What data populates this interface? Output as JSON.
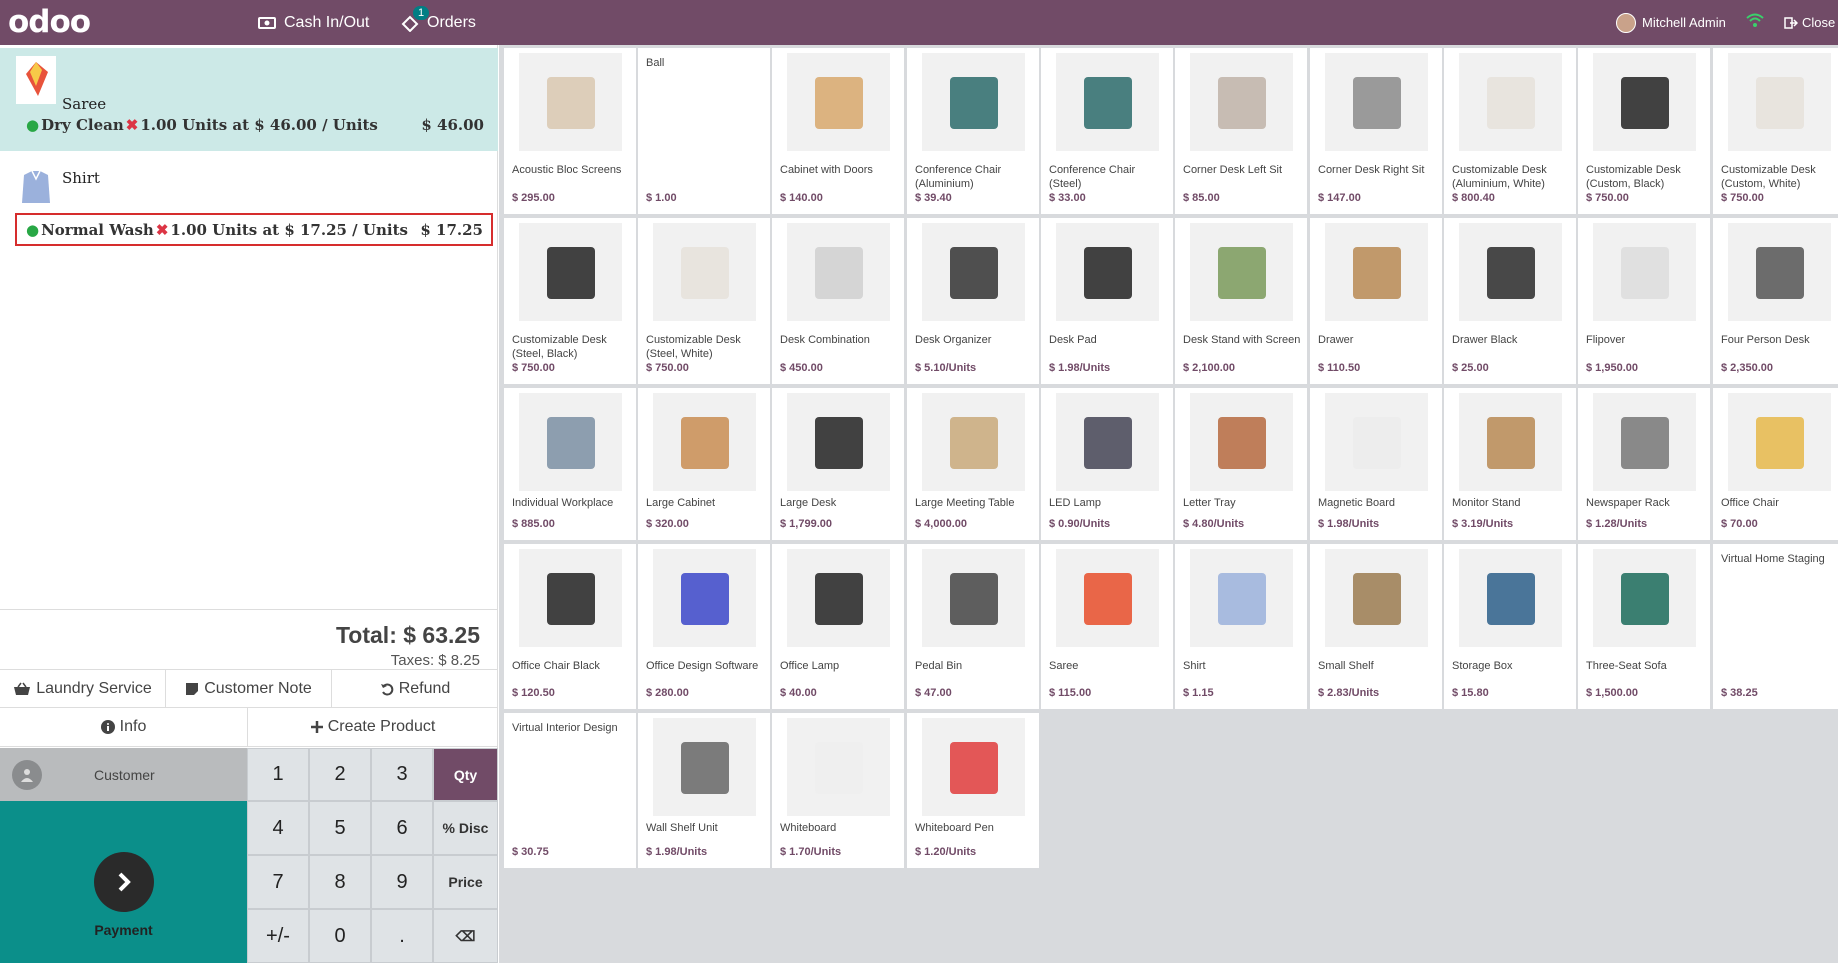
{
  "header": {
    "logo": "odoo",
    "cash_label": "Cash In/Out",
    "orders_label": "Orders",
    "orders_badge": "1",
    "user_name": "Mitchell Admin",
    "close_label": "Close"
  },
  "order": {
    "lines": [
      {
        "product": "Saree",
        "service": "Dry Clean",
        "qty_text": "1.00 Units at $ 46.00 / Units",
        "price": "$ 46.00",
        "selected": true
      },
      {
        "product": "Shirt",
        "service": "Normal Wash",
        "qty_text": "1.00 Units at $ 17.25 / Units",
        "price": "$ 17.25",
        "selected": false
      }
    ],
    "total": "Total: $ 63.25",
    "taxes": "Taxes: $ 8.25"
  },
  "controls": {
    "laundry_service": "Laundry Service",
    "customer_note": "Customer Note",
    "refund": "Refund",
    "info": "Info",
    "create_product": "Create Product",
    "customer": "Customer",
    "payment": "Payment"
  },
  "numpad": {
    "keys": [
      "1",
      "2",
      "3",
      "Qty",
      "4",
      "5",
      "6",
      "% Disc",
      "7",
      "8",
      "9",
      "Price",
      "+/-",
      "0",
      ".",
      "⌫"
    ],
    "active_mode": "Qty"
  },
  "products": [
    {
      "name": "Acoustic Bloc Screens",
      "price": "$ 295.00"
    },
    {
      "name": "Ball",
      "price": "$ 1.00"
    },
    {
      "name": "Cabinet with Doors",
      "price": "$ 140.00"
    },
    {
      "name": "Conference Chair (Aluminium)",
      "price": "$ 39.40"
    },
    {
      "name": "Conference Chair (Steel)",
      "price": "$ 33.00"
    },
    {
      "name": "Corner Desk Left Sit",
      "price": "$ 85.00"
    },
    {
      "name": "Corner Desk Right Sit",
      "price": "$ 147.00"
    },
    {
      "name": "Customizable Desk (Aluminium, White)",
      "price": "$ 800.40"
    },
    {
      "name": "Customizable Desk (Custom, Black)",
      "price": "$ 750.00"
    },
    {
      "name": "Customizable Desk (Custom, White)",
      "price": "$ 750.00"
    },
    {
      "name": "Customizable Desk (Steel, Black)",
      "price": "$ 750.00"
    },
    {
      "name": "Customizable Desk (Steel, White)",
      "price": "$ 750.00"
    },
    {
      "name": "Desk Combination",
      "price": "$ 450.00"
    },
    {
      "name": "Desk Organizer",
      "price": "$ 5.10/Units"
    },
    {
      "name": "Desk Pad",
      "price": "$ 1.98/Units"
    },
    {
      "name": "Desk Stand with Screen",
      "price": "$ 2,100.00"
    },
    {
      "name": "Drawer",
      "price": "$ 110.50"
    },
    {
      "name": "Drawer Black",
      "price": "$ 25.00"
    },
    {
      "name": "Flipover",
      "price": "$ 1,950.00"
    },
    {
      "name": "Four Person Desk",
      "price": "$ 2,350.00"
    },
    {
      "name": "Individual Workplace",
      "price": "$ 885.00"
    },
    {
      "name": "Large Cabinet",
      "price": "$ 320.00"
    },
    {
      "name": "Large Desk",
      "price": "$ 1,799.00"
    },
    {
      "name": "Large Meeting Table",
      "price": "$ 4,000.00"
    },
    {
      "name": "LED Lamp",
      "price": "$ 0.90/Units"
    },
    {
      "name": "Letter Tray",
      "price": "$ 4.80/Units"
    },
    {
      "name": "Magnetic Board",
      "price": "$ 1.98/Units"
    },
    {
      "name": "Monitor Stand",
      "price": "$ 3.19/Units"
    },
    {
      "name": "Newspaper Rack",
      "price": "$ 1.28/Units"
    },
    {
      "name": "Office Chair",
      "price": "$ 70.00"
    },
    {
      "name": "Office Chair Black",
      "price": "$ 120.50"
    },
    {
      "name": "Office Design Software",
      "price": "$ 280.00"
    },
    {
      "name": "Office Lamp",
      "price": "$ 40.00"
    },
    {
      "name": "Pedal Bin",
      "price": "$ 47.00"
    },
    {
      "name": "Saree",
      "price": "$ 115.00"
    },
    {
      "name": "Shirt",
      "price": "$ 1.15"
    },
    {
      "name": "Small Shelf",
      "price": "$ 2.83/Units"
    },
    {
      "name": "Storage Box",
      "price": "$ 15.80"
    },
    {
      "name": "Three-Seat Sofa",
      "price": "$ 1,500.00"
    },
    {
      "name": "Virtual Home Staging",
      "price": "$ 38.25"
    },
    {
      "name": "Virtual Interior Design",
      "price": "$ 30.75"
    },
    {
      "name": "Wall Shelf Unit",
      "price": "$ 1.98/Units"
    },
    {
      "name": "Whiteboard",
      "price": "$ 1.70/Units"
    },
    {
      "name": "Whiteboard Pen",
      "price": "$ 1.20/Units"
    }
  ],
  "colors": {
    "brand": "#714b67",
    "selected_line": "#cce9e7",
    "payment": "#0b8f8a",
    "price_text": "#714b67"
  }
}
